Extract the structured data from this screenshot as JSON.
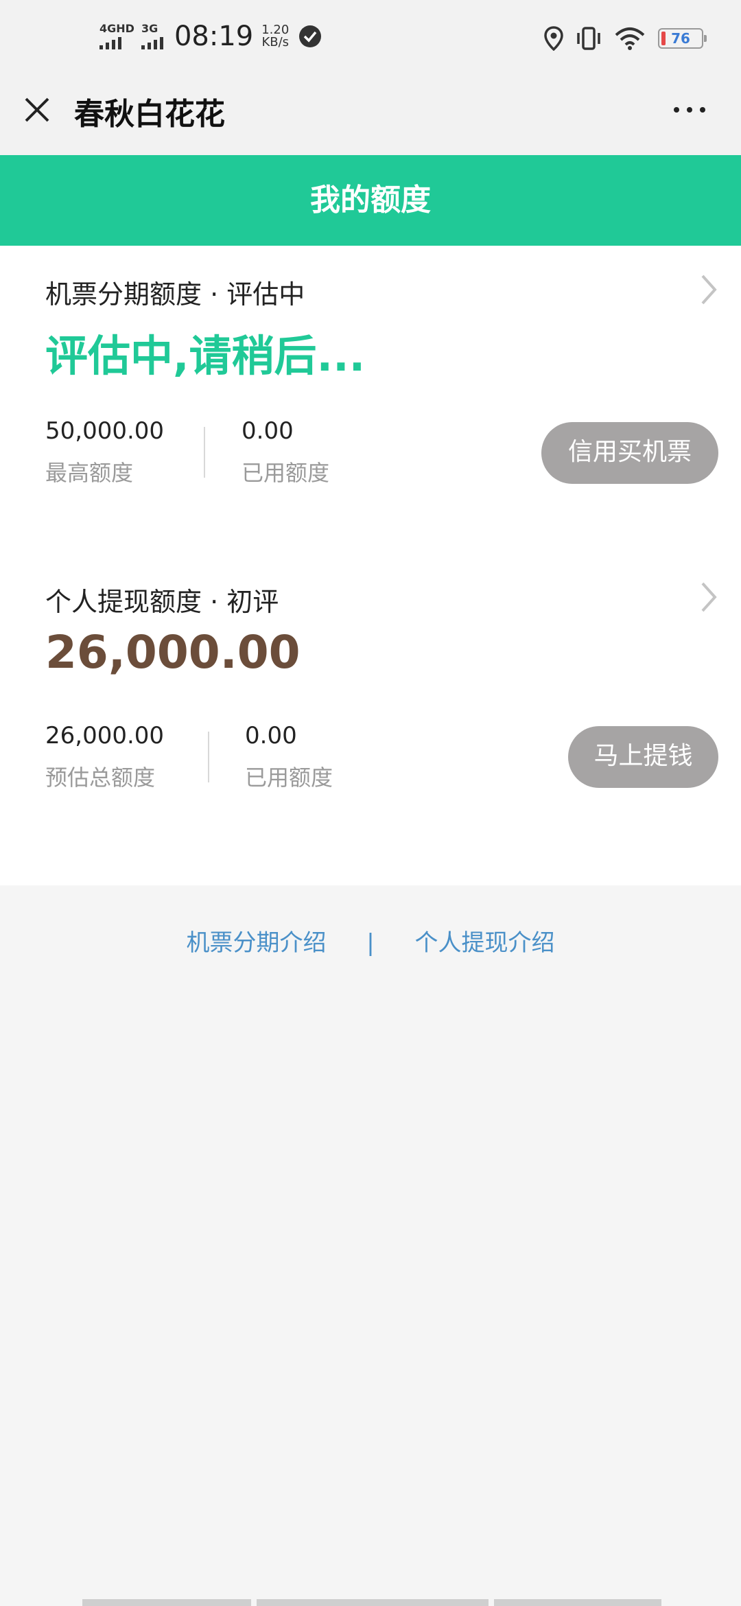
{
  "status_bar": {
    "network1": "4GHD",
    "network2": "3G",
    "time": "08:19",
    "speed_value": "1.20",
    "speed_unit": "KB/s",
    "battery": "76"
  },
  "nav": {
    "title": "春秋白花花"
  },
  "banner": {
    "title": "我的额度"
  },
  "flight_credit": {
    "title": "机票分期额度 · 评估中",
    "status": "评估中,请稍后...",
    "max_value": "50,000.00",
    "max_label": "最高额度",
    "used_value": "0.00",
    "used_label": "已用额度",
    "button": "信用买机票"
  },
  "cash_credit": {
    "title": "个人提现额度 · 初评",
    "amount": "26,000.00",
    "total_value": "26,000.00",
    "total_label": "预估总额度",
    "used_value": "0.00",
    "used_label": "已用额度",
    "button": "马上提钱"
  },
  "footer": {
    "link1": "机票分期介绍",
    "separator": "|",
    "link2": "个人提现介绍"
  },
  "colors": {
    "accent": "#20c997",
    "amount": "#6b4d3a",
    "link": "#4a90c8",
    "button": "#a6a4a4"
  }
}
